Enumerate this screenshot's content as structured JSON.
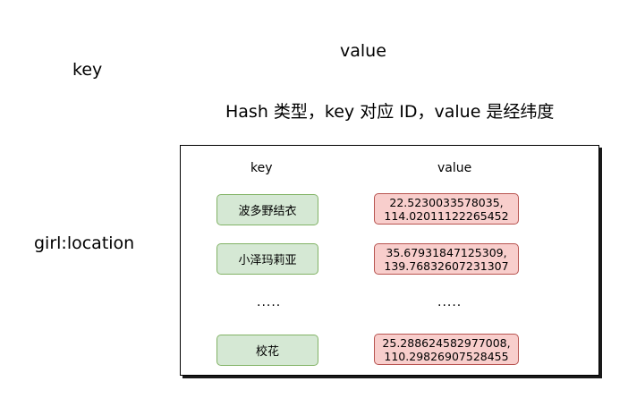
{
  "labels": {
    "top_key": "key",
    "top_value": "value",
    "description": "Hash 类型，key 对应 ID，value 是经纬度",
    "hash_name": "girl:location"
  },
  "table": {
    "key_header": "key",
    "value_header": "value",
    "rows": [
      {
        "key": "波多野结衣",
        "value_line1": "22.5230033578035,",
        "value_line2": "114.02011122265452"
      },
      {
        "key": "小泽玛莉亚",
        "value_line1": "35.67931847125309,",
        "value_line2": "139.76832607231307"
      },
      {
        "key": "校花",
        "value_line1": "25.288624582977008,",
        "value_line2": "110.29826907528455"
      }
    ],
    "ellipsis_key": ".....",
    "ellipsis_value": "....."
  },
  "colors": {
    "key_fill": "#d5e8d4",
    "key_border": "#82b366",
    "value_fill": "#f8cecc",
    "value_border": "#b85450"
  }
}
